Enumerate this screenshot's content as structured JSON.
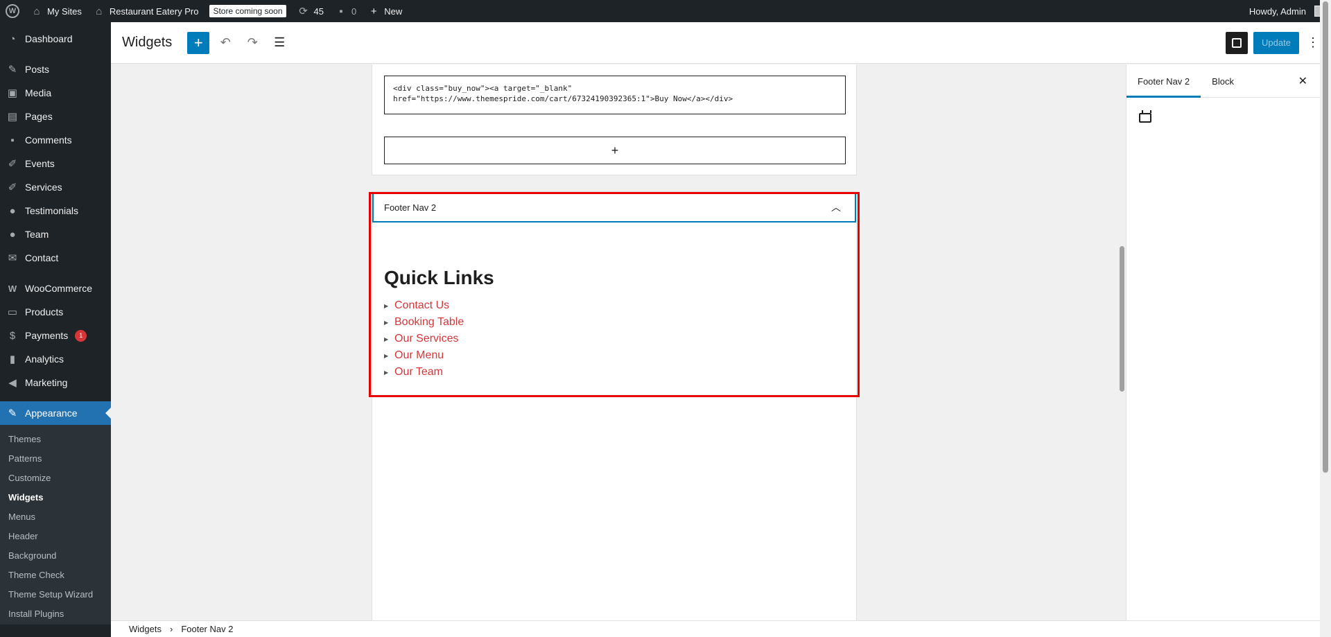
{
  "adminbar": {
    "my_sites": "My Sites",
    "site_name": "Restaurant Eatery Pro",
    "store_badge": "Store coming soon",
    "updates_count": "45",
    "comments_count": "0",
    "new_label": "New",
    "howdy": "Howdy, Admin"
  },
  "sidebar": {
    "items": [
      {
        "label": "Dashboard",
        "icon": "dashboard-icon"
      },
      {
        "label": "Posts",
        "icon": "pin-icon"
      },
      {
        "label": "Media",
        "icon": "media-icon"
      },
      {
        "label": "Pages",
        "icon": "pages-icon"
      },
      {
        "label": "Comments",
        "icon": "comment-icon"
      },
      {
        "label": "Events",
        "icon": "brush-icon"
      },
      {
        "label": "Services",
        "icon": "brush-icon"
      },
      {
        "label": "Testimonials",
        "icon": "user-icon"
      },
      {
        "label": "Team",
        "icon": "user-icon"
      },
      {
        "label": "Contact",
        "icon": "mail-icon"
      },
      {
        "label": "WooCommerce",
        "icon": "woo-icon"
      },
      {
        "label": "Products",
        "icon": "archive-icon"
      },
      {
        "label": "Payments",
        "icon": "dollar-icon",
        "badge": "1"
      },
      {
        "label": "Analytics",
        "icon": "chart-icon"
      },
      {
        "label": "Marketing",
        "icon": "megaphone-icon"
      },
      {
        "label": "Appearance",
        "icon": "paintbrush-icon"
      }
    ],
    "submenu": [
      "Themes",
      "Patterns",
      "Customize",
      "Widgets",
      "Menus",
      "Header",
      "Background",
      "Theme Check",
      "Theme Setup Wizard",
      "Install Plugins"
    ]
  },
  "header": {
    "title": "Widgets",
    "update_label": "Update"
  },
  "canvas": {
    "html_code": "<div class=\"buy_now\"><a target=\"_blank\"\nhref=\"https://www.themespride.com/cart/67324190392365:1\">Buy Now</a></div>",
    "appender": "+",
    "widget_area_title": "Footer Nav 2",
    "quick_links_title": "Quick Links",
    "links": [
      "Contact Us",
      "Booking Table",
      "Our Services",
      "Our Menu",
      "Our Team"
    ]
  },
  "inspector": {
    "tabs": [
      "Footer Nav 2",
      "Block"
    ]
  },
  "footer": {
    "crumbs": [
      "Widgets",
      "Footer Nav 2"
    ]
  },
  "colors": {
    "accent": "#007cba",
    "admin_bg": "#1d2327",
    "link_red": "#d63638",
    "highlight": "#e80000"
  }
}
